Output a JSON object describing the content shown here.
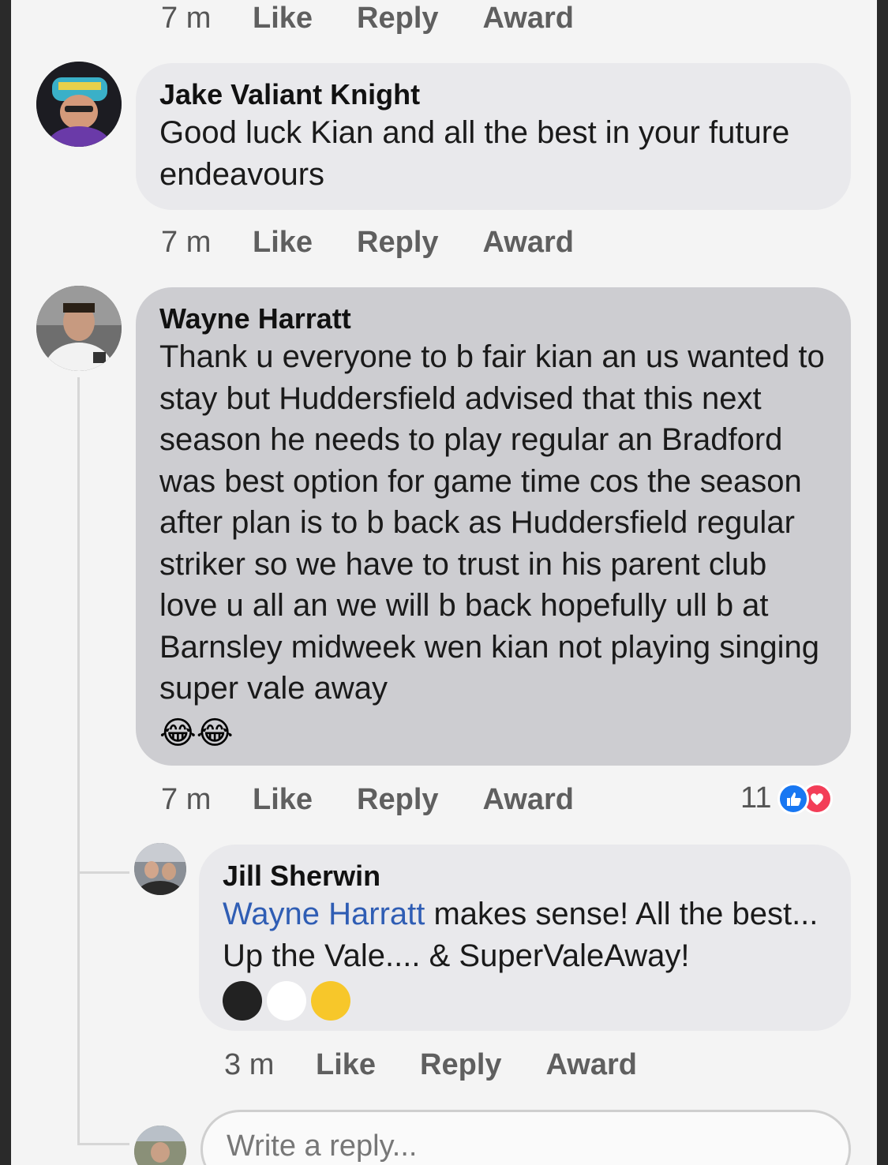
{
  "comments": [
    {
      "actions": {
        "time": "7 m",
        "like": "Like",
        "reply": "Reply",
        "award": "Award"
      }
    },
    {
      "author": "Jake Valiant Knight",
      "text": "Good luck Kian and all the best in your future endeavours",
      "actions": {
        "time": "7 m",
        "like": "Like",
        "reply": "Reply",
        "award": "Award"
      }
    },
    {
      "author": "Wayne Harratt",
      "text": "Thank u everyone to b fair kian an us wanted to stay but Huddersfield advised that this next season he needs to play regular an Bradford was best option for game time cos the season after plan is to b back as Huddersfield regular striker so we have to trust in his parent club love u all an we will b back hopefully ull b at Barnsley midweek wen kian not playing singing super vale away",
      "emojis": "😂😂",
      "actions": {
        "time": "7 m",
        "like": "Like",
        "reply": "Reply",
        "award": "Award"
      },
      "reactions": {
        "count": "11",
        "icons": [
          "like-icon",
          "love-icon"
        ]
      }
    },
    {
      "author": "Jill Sherwin",
      "mention": "Wayne Harratt",
      "text": " makes sense! All the best... Up the Vale.... & SuperValeAway!",
      "emojis": [
        "black-circle",
        "white-circle",
        "yellow-circle"
      ],
      "actions": {
        "time": "3 m",
        "like": "Like",
        "reply": "Reply",
        "award": "Award"
      }
    }
  ],
  "reply_box": {
    "placeholder": "Write a reply..."
  },
  "colors": {
    "mention": "#2f5db4",
    "bubble": "#e9e9ec",
    "highlight_bubble": "#cdcdd1",
    "like_blue": "#1877f2",
    "love_red": "#f33e58"
  }
}
